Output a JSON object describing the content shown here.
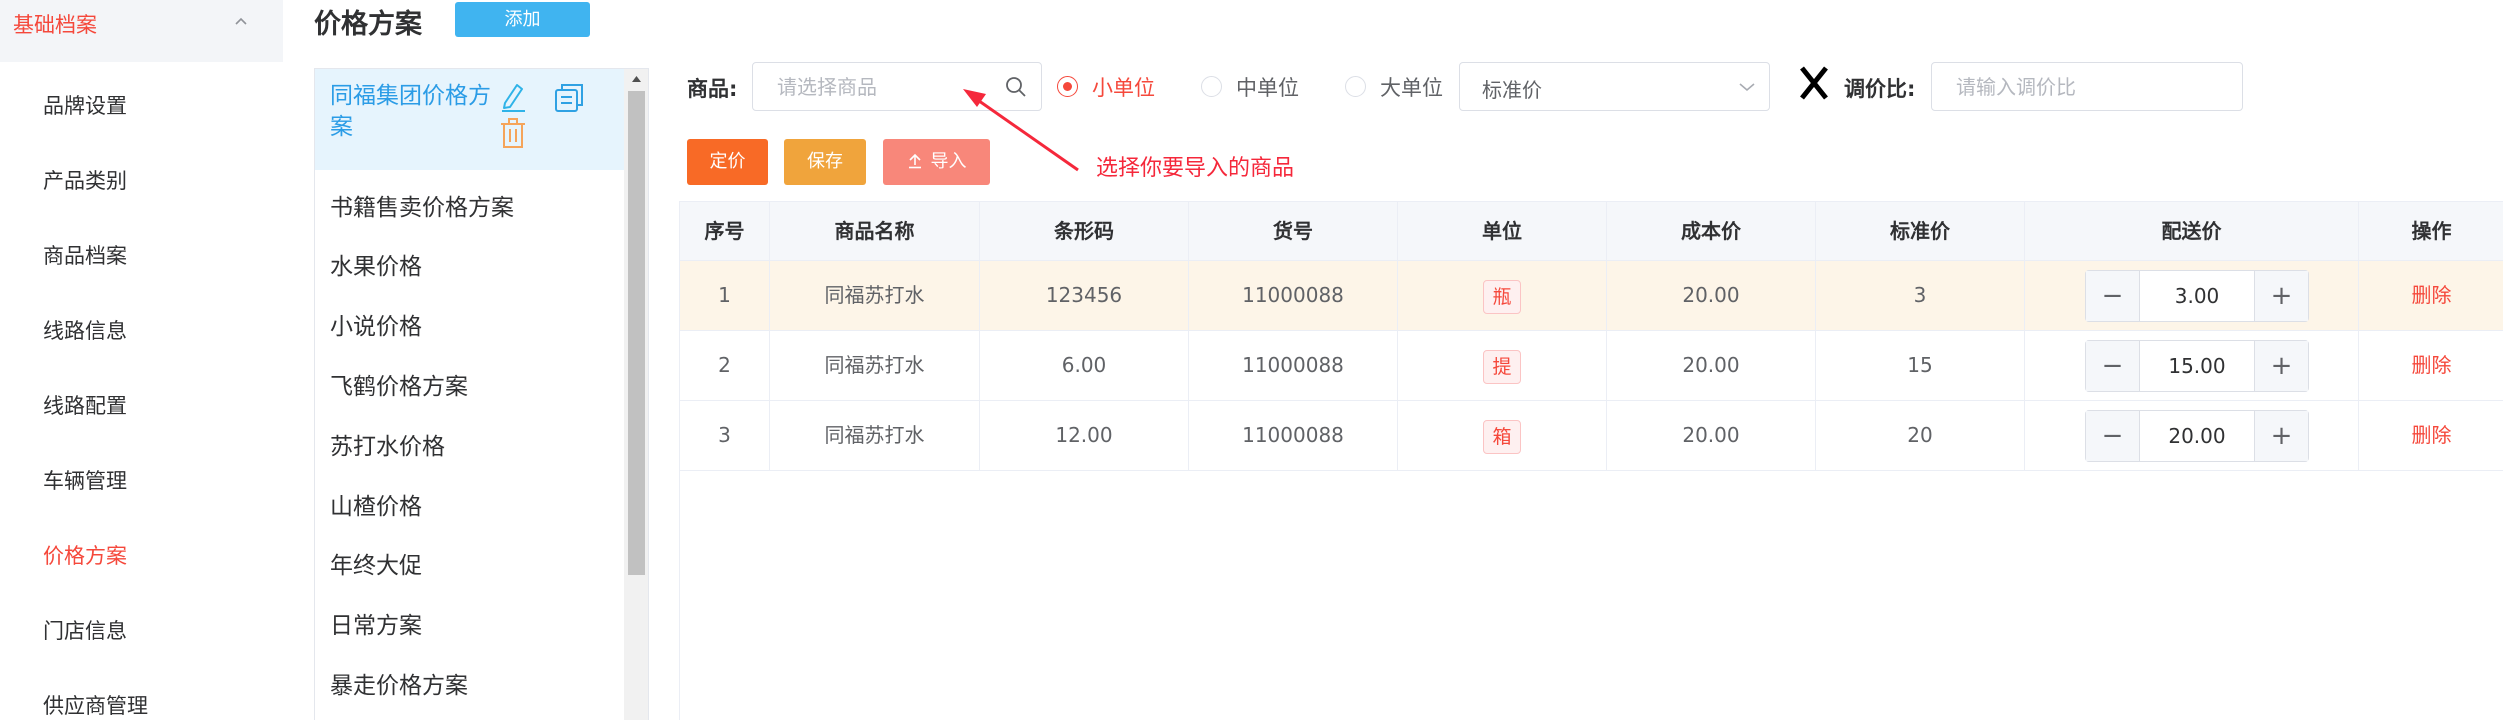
{
  "sidebar": {
    "group_label": "基础档案",
    "items": [
      {
        "label": "品牌设置"
      },
      {
        "label": "产品类别"
      },
      {
        "label": "商品档案"
      },
      {
        "label": "线路信息"
      },
      {
        "label": "线路配置"
      },
      {
        "label": "车辆管理"
      },
      {
        "label": "价格方案",
        "active": true
      },
      {
        "label": "门店信息"
      },
      {
        "label": "供应商管理"
      }
    ]
  },
  "header": {
    "title": "价格方案",
    "add_label": "添加"
  },
  "schemes": {
    "active_label": "同福集团价格方案",
    "items": [
      "书籍售卖价格方案",
      "水果价格",
      "小说价格",
      "飞鹤价格方案",
      "苏打水价格",
      "山楂价格",
      "年终大促",
      "日常方案",
      "暴走价格方案"
    ]
  },
  "filters": {
    "goods_label": "商品:",
    "goods_placeholder": "请选择商品",
    "units": [
      {
        "label": "小单位",
        "checked": true
      },
      {
        "label": "中单位",
        "checked": false
      },
      {
        "label": "大单位",
        "checked": false
      }
    ],
    "price_type": "标准价",
    "ratio_label": "调价比:",
    "ratio_placeholder": "请输入调价比"
  },
  "actions": {
    "price_label": "定价",
    "save_label": "保存",
    "import_label": "导入"
  },
  "annotation": "选择你要导入的商品",
  "table": {
    "columns": [
      "序号",
      "商品名称",
      "条形码",
      "货号",
      "单位",
      "成本价",
      "标准价",
      "配送价",
      "操作"
    ],
    "rows": [
      {
        "index": "1",
        "name": "同福苏打水",
        "barcode": "123456",
        "sku": "11000088",
        "unit": "瓶",
        "cost": "20.00",
        "standard": "3",
        "delivery": "3.00",
        "action": "删除"
      },
      {
        "index": "2",
        "name": "同福苏打水",
        "barcode": "6.00",
        "sku": "11000088",
        "unit": "提",
        "cost": "20.00",
        "standard": "15",
        "delivery": "15.00",
        "action": "删除"
      },
      {
        "index": "3",
        "name": "同福苏打水",
        "barcode": "12.00",
        "sku": "11000088",
        "unit": "箱",
        "cost": "20.00",
        "standard": "20",
        "delivery": "20.00",
        "action": "删除"
      }
    ]
  },
  "colors": {
    "accent": "#f5483b",
    "primary_blue": "#40b4f0",
    "btn_price": "#f86a26",
    "btn_save": "#f0a43c",
    "btn_import": "#f8877a",
    "row_highlight": "#fdf5e8"
  },
  "icons": [
    "chevron-up-icon",
    "edit-icon",
    "copy-icon",
    "trash-icon",
    "search-icon",
    "chevron-down-icon",
    "upload-icon",
    "x-icon",
    "minus-icon",
    "plus-icon",
    "red-arrow-icon"
  ]
}
